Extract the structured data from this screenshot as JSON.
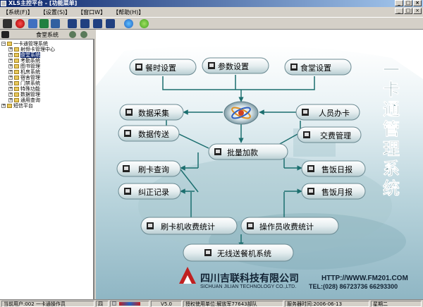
{
  "window": {
    "title": "XLS主控平台 - [功能菜单]"
  },
  "menu": [
    "【系统(F)】",
    "【设置(S)】",
    "【窗口W】",
    "【帮助(H)】"
  ],
  "panel": {
    "title": "食堂系统"
  },
  "tree": [
    {
      "label": "一卡通管理系统",
      "level": 0,
      "expanded": true
    },
    {
      "label": "射频卡管理中心",
      "level": 1,
      "expanded": false
    },
    {
      "label": "食堂系统",
      "level": 1,
      "expanded": false,
      "selected": true
    },
    {
      "label": "考勤系统",
      "level": 1,
      "expanded": false
    },
    {
      "label": "图书管理",
      "level": 1,
      "expanded": false
    },
    {
      "label": "机房系统",
      "level": 1,
      "expanded": false
    },
    {
      "label": "宿舍管理",
      "level": 1,
      "expanded": false
    },
    {
      "label": "门禁系统",
      "level": 1,
      "expanded": false
    },
    {
      "label": "特殊功能",
      "level": 1,
      "expanded": false
    },
    {
      "label": "数据管理",
      "level": 1,
      "expanded": false
    },
    {
      "label": "通用查询",
      "level": 1,
      "expanded": false
    },
    {
      "label": "短信平台",
      "level": 0,
      "expanded": false
    }
  ],
  "diagram": {
    "nodes": {
      "meal_time": "餐时设置",
      "params": "参数设置",
      "canteen": "食堂设置",
      "data_collect": "数据采集",
      "data_transfer": "数据传送",
      "card_issue": "人员办卡",
      "trans_mgmt": "交费管理",
      "batch_add": "批量加款",
      "swipe_query": "刷卡查询",
      "correction": "纠正记录",
      "sales_day": "售饭日报",
      "sales_month": "售饭月报",
      "machine_stats": "刷卡机收费统计",
      "operator_stats": "操作员收费统计",
      "wireless": "无线送餐机系统"
    },
    "vertical_title": "一卡通管理系统",
    "company": {
      "name_cn": "四川吉联科技有限公司",
      "name_en": "SICHUAN JILIAN TECHNOLOGY CO.,LTD.",
      "url": "HTTP://WWW.FM201.COM",
      "tel": "TEL:(028) 86723736  66293300"
    }
  },
  "status": {
    "user": "当前用户:002 一卡通操作员",
    "module": "四",
    "version": "V5.0",
    "license": "授权使用单位:解放军77643部队",
    "server_time": "服务器时间:2006-06-13",
    "weekday": "星期二"
  }
}
